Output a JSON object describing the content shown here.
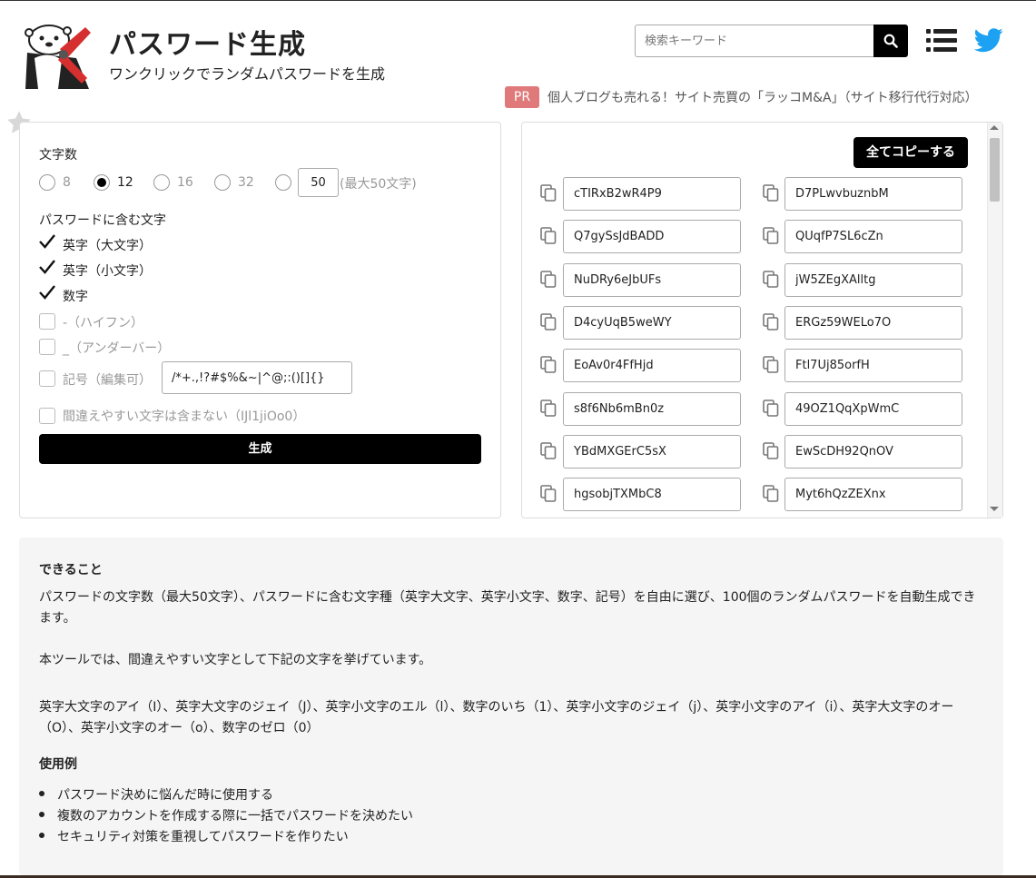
{
  "header": {
    "title": "パスワード生成",
    "subtitle": "ワンクリックでランダムパスワードを生成",
    "search_placeholder": "検索キーワード",
    "logo_icon": "otter-with-pliers-icon",
    "search_icon": "search-icon",
    "menu_icon": "list-menu-icon",
    "twitter_icon": "twitter-bird-icon",
    "twitter_color": "#1da1f2"
  },
  "promo": {
    "badge": "PR",
    "text": "個人ブログも売れる！サイト売買の「ラッコM&A」（サイト移行代行対応）",
    "badge_color": "#e07a7a"
  },
  "form": {
    "length_label": "文字数",
    "length_options": [
      "8",
      "12",
      "16",
      "32"
    ],
    "selected_length": "12",
    "custom_length": "50",
    "max_note": "(最大50文字)",
    "charset_label": "パスワードに含む文字",
    "options": [
      {
        "label": "英字（大文字）",
        "checked": true
      },
      {
        "label": "英字（小文字）",
        "checked": true
      },
      {
        "label": "数字",
        "checked": true
      },
      {
        "label": "-（ハイフン）",
        "checked": false
      },
      {
        "label": "_（アンダーバー）",
        "checked": false
      },
      {
        "label": "記号（編集可）",
        "checked": false
      },
      {
        "label": "間違えやすい文字は含まない（IJl1jiOo0）",
        "checked": false
      }
    ],
    "symbols_value": "/*+.,!?#$%&~|^@;:()[]{}",
    "generate_label": "生成"
  },
  "results": {
    "copy_all_label": "全てコピーする",
    "passwords": [
      [
        "cTIRxB2wR4P9",
        "D7PLwvbuznbM"
      ],
      [
        "Q7gySsJdBADD",
        "QUqfP7SL6cZn"
      ],
      [
        "NuDRy6eJbUFs",
        "jW5ZEgXAlltg"
      ],
      [
        "D4cyUqB5weWY",
        "ERGz59WELo7O"
      ],
      [
        "EoAv0r4FfHjd",
        "Ftl7Uj85orfH"
      ],
      [
        "s8f6Nb6mBn0z",
        "49OZ1QqXpWmC"
      ],
      [
        "YBdMXGErC5sX",
        "EwScDH92QnOV"
      ],
      [
        "hgsobjTXMbC8",
        "Myt6hQzZEXnx"
      ]
    ],
    "copy_icon": "copy-icon"
  },
  "info": {
    "can_do_heading": "できること",
    "can_do_text": "パスワードの文字数（最大50文字）、パスワードに含む文字種（英字大文字、英字小文字、数字、記号）を自由に選び、100個のランダムパスワードを自動生成できます。",
    "confusing_text": "本ツールでは、間違えやすい文字として下記の文字を挙げています。",
    "confusing_list": "英字大文字のアイ（I）、英字大文字のジェイ（J）、英字小文字のエル（l）、数字のいち（1）、英字小文字のジェイ（j）、英字小文字のアイ（i）、英字大文字のオー（O）、英字小文字のオー（o）、数字のゼロ（0）",
    "examples_heading": "使用例",
    "examples": [
      "パスワード決めに悩んだ時に使用する",
      "複数のアカウントを作成する際に一括でパスワードを決めたい",
      "セキュリティ対策を重視してパスワードを作りたい"
    ]
  },
  "favorite_icon": "star-icon"
}
